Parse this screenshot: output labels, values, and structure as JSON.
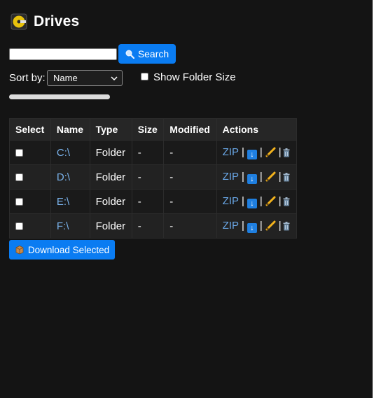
{
  "header": {
    "title": "Drives",
    "icon": "cd-drive-icon"
  },
  "search": {
    "placeholder": "",
    "value": "",
    "button_label": "Search",
    "button_icon": "magnifier-icon"
  },
  "sort": {
    "label": "Sort by:",
    "selected": "Name",
    "options": [
      "Name"
    ]
  },
  "folder_size": {
    "label": "Show Folder Size",
    "checked": false
  },
  "progress": {
    "fraction": 0.0
  },
  "table": {
    "headers": [
      "Select",
      "Name",
      "Type",
      "Size",
      "Modified",
      "Actions"
    ],
    "rows": [
      {
        "name": "C:\\",
        "type": "Folder",
        "size": "-",
        "modified": "-"
      },
      {
        "name": "D:\\",
        "type": "Folder",
        "size": "-",
        "modified": "-"
      },
      {
        "name": "E:\\",
        "type": "Folder",
        "size": "-",
        "modified": "-"
      },
      {
        "name": "F:\\",
        "type": "Folder",
        "size": "-",
        "modified": "-"
      }
    ],
    "actions": {
      "zip": "ZIP",
      "separator": "|",
      "download_icon": "download-icon",
      "rename_icon": "pencil-icon",
      "delete_icon": "trash-icon"
    }
  },
  "download_selected": {
    "label": "Download Selected",
    "icon": "package-icon"
  },
  "colors": {
    "background": "#141414",
    "accent": "#0a7cf2",
    "link": "#7ab3ec"
  }
}
